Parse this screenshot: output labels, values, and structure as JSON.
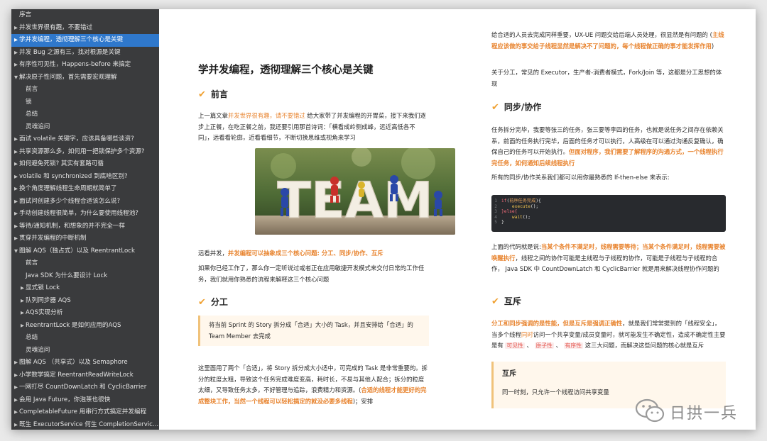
{
  "sidebar": {
    "items": [
      {
        "label": "序言",
        "level": 0,
        "arrow": "",
        "active": false
      },
      {
        "label": "并发世界很有趣，不要错过",
        "level": 0,
        "arrow": "▶",
        "active": false
      },
      {
        "label": "学并发编程，透彻理解三个核心是关键",
        "level": 0,
        "arrow": "▶",
        "active": true
      },
      {
        "label": "并发 Bug 之源有三，找对根源是关键",
        "level": 0,
        "arrow": "▶",
        "active": false
      },
      {
        "label": "有序性可见性，Happens-before 来搞定",
        "level": 0,
        "arrow": "▶",
        "active": false
      },
      {
        "label": "解决原子性问题，首先需要宏观理解",
        "level": 0,
        "arrow": "▼",
        "active": false
      },
      {
        "label": "前言",
        "level": 2,
        "arrow": "",
        "active": false
      },
      {
        "label": "锁",
        "level": 2,
        "arrow": "",
        "active": false
      },
      {
        "label": "总结",
        "level": 2,
        "arrow": "",
        "active": false
      },
      {
        "label": "灵魂追问",
        "level": 2,
        "arrow": "",
        "active": false
      },
      {
        "label": "面试 volatile 关键字，应该具备哪些谈资?",
        "level": 0,
        "arrow": "▶",
        "active": false
      },
      {
        "label": "共享资源那么多，如何用一把锁保护多个资源?",
        "level": 0,
        "arrow": "▶",
        "active": false
      },
      {
        "label": "如何避免死锁? 其实有套路可循",
        "level": 0,
        "arrow": "▶",
        "active": false
      },
      {
        "label": "volatile 和 synchronized 到底啥区别?",
        "level": 0,
        "arrow": "▶",
        "active": false
      },
      {
        "label": "换个角度理解线程生命周期就简单了",
        "level": 0,
        "arrow": "▶",
        "active": false
      },
      {
        "label": "面试问创建多少个线程合适该怎么说?",
        "level": 0,
        "arrow": "▶",
        "active": false
      },
      {
        "label": "手动创建线程很简单，为什么要使用线程池?",
        "level": 0,
        "arrow": "▶",
        "active": false
      },
      {
        "label": "等待/通知机制，和想象的并不完全一样",
        "level": 0,
        "arrow": "▶",
        "active": false
      },
      {
        "label": "贯穿并发编程的中断机制",
        "level": 0,
        "arrow": "▶",
        "active": false
      },
      {
        "label": "图解 AQS（独占式）以及 ReentrantLock",
        "level": 0,
        "arrow": "▼",
        "active": false
      },
      {
        "label": "前言",
        "level": 2,
        "arrow": "",
        "active": false
      },
      {
        "label": "Java SDK 为什么要设计 Lock",
        "level": 2,
        "arrow": "",
        "active": false
      },
      {
        "label": "显式锁 Lock",
        "level": 1,
        "arrow": "▶",
        "active": false
      },
      {
        "label": "队列同步器 AQS",
        "level": 1,
        "arrow": "▶",
        "active": false
      },
      {
        "label": "AQS实现分析",
        "level": 1,
        "arrow": "▶",
        "active": false
      },
      {
        "label": "ReentrantLock 是如何应用的AQS",
        "level": 1,
        "arrow": "▶",
        "active": false
      },
      {
        "label": "总结",
        "level": 2,
        "arrow": "",
        "active": false
      },
      {
        "label": "灵魂追问",
        "level": 2,
        "arrow": "",
        "active": false
      },
      {
        "label": "图解 AQS （共享式）以及 Semaphore",
        "level": 0,
        "arrow": "▶",
        "active": false
      },
      {
        "label": "小学数学搞定 ReentrantReadWriteLock",
        "level": 0,
        "arrow": "▶",
        "active": false
      },
      {
        "label": "一网打尽 CountDownLatch 和 CyclicBarrier",
        "level": 0,
        "arrow": "▶",
        "active": false
      },
      {
        "label": "会用 Java Future，你泡茶也很快",
        "level": 0,
        "arrow": "▶",
        "active": false
      },
      {
        "label": "CompletableFuture 用串行方式搞定并发编程",
        "level": 0,
        "arrow": "▶",
        "active": false
      },
      {
        "label": "既生 ExecutorService 何生 CompletionServic...",
        "level": 0,
        "arrow": "▶",
        "active": false
      }
    ]
  },
  "article": {
    "title": "学并发编程，透彻理解三个核心是关键",
    "sec_intro": "前言",
    "intro_p1_a": "上一篇文章",
    "intro_p1_link": "并发世界很有趣，请不要错过",
    "intro_p1_b": " 给大家带了并发编程的开胃菜，接下来我们逐步上正餐，在吃正餐之前，我还要引用那首诗词：「横看成岭侧成峰，远近高低各不同」，远看看轮廓，近看看细节，不断切换思维或视角来学习",
    "team_text": "TEAM",
    "after_img_a": "远看并发，",
    "after_img_hl": "并发编程可以抽象成三个核心问题: 分工、同步/协作、互斥",
    "after_img_p2": "如果你已经工作了，那么你一定听说过或者正在应用敏捷开发模式来交付日常的工作任务，我们就用你熟悉的流程来解释这三个核心问题",
    "sec_divide": "分工",
    "quote1": "将当前 Sprint 的 Story 拆分成「合适」大小的 Task，并且安排给「合适」的 Team Member 去完成",
    "divide_p1_a": "这里面用了两个「合适」，将 Story 拆分成大小适中，可完成的 Task 是非常重要的。拆分的粒度太粗，导致这个任务完成难度变高，耗时长，不易与其他人配合；拆分的粒度太细，又导致任务太多，不好管理与追踪，浪费精力和资源。(",
    "divide_p1_hl": "合适的线程才能更好的完成整块工作，当然一个线程可以轻松搞定的就没必要多线程",
    "divide_p1_b": ")；安排",
    "right_p1_a": "给合适的人员去完成同样重要，UX-UE 问题交给后端人员处理，很显然是有问题的 (",
    "right_p1_hl": "主线程应该做的事交给子线程显然是解决不了问题的，每个线程做正确的事才能发挥作用",
    "right_p1_b": ")",
    "right_p2": "关于分工，常见的 Executor，生产者-消费者模式，Fork/Join 等，这都是分工思想的体现",
    "sec_sync": "同步/协作",
    "sync_p1_a": "任务拆分完毕，我要等张三的任务，张三要等李四的任务，也就是说任务之间存在依赖关系，前面的任务执行完毕，后面的任务才可以执行，人高级在可以通过沟通反复确认，确保自己的任务可以开始执行。",
    "sync_p1_hl": "但面对程序，我们需要了解程序的沟通方式，一个线程执行完任务，如何通知后续线程执行",
    "sync_p2": "所有的同步/协作关系我们都可以用你最熟悉的 If-then-else 来表示:",
    "code": {
      "lines": [
        {
          "ln": "1",
          "kw": "if",
          "rest_a": "(",
          "cn": "前序任务完成",
          "rest_b": "){"
        },
        {
          "ln": "2",
          "fn": "execute",
          "rest": "();"
        },
        {
          "ln": "3",
          "kw": "}else{"
        },
        {
          "ln": "4",
          "fn": "wait",
          "rest": "();"
        },
        {
          "ln": "5",
          "rest": "}"
        }
      ]
    },
    "sync_p3_a": "上面的代码就是说:",
    "sync_p3_hl": "当某个条件不满足时，线程需要等待；当某个条件满足时，线程需要被唤醒执行",
    "sync_p3_b": "，线程之间的协作可能是主线程与子线程的协作，可能是子线程与子线程的合作， Java SDK 中 CountDownLatch 和 CyclicBarrier 就是用来解决线程协作问题的",
    "sec_mutex": "互斥",
    "mutex_p1_hl": "分工和同步强调的是性能，但是互斥是强调正确性",
    "mutex_p1_a": "，就是我们常常提到的「线程安全」，当多个线程",
    "mutex_p1_hl2": "同时",
    "mutex_p1_b": "访问一个共享变量/成员变量时，就可能发生不确定性，造成不确定性主要是有 ",
    "tag1": "可见性",
    "sep1": " 、 ",
    "tag2": "原子性",
    "sep2": " 、 ",
    "tag3": "有序性",
    "mutex_p1_c": " 这三大问题，而解决这些问题的核心就是互斥",
    "quote2_title": "互斥",
    "quote2_body": "同一时刻，只允许一个线程访问共享变量"
  },
  "watermark": {
    "text": "日拱一兵"
  },
  "colors": {
    "sidebar_bg": "#3a3b3d",
    "active_item": "#2f78cc",
    "highlight": "#e8842f",
    "check": "#f0a132",
    "code_bg": "#282a2e"
  }
}
